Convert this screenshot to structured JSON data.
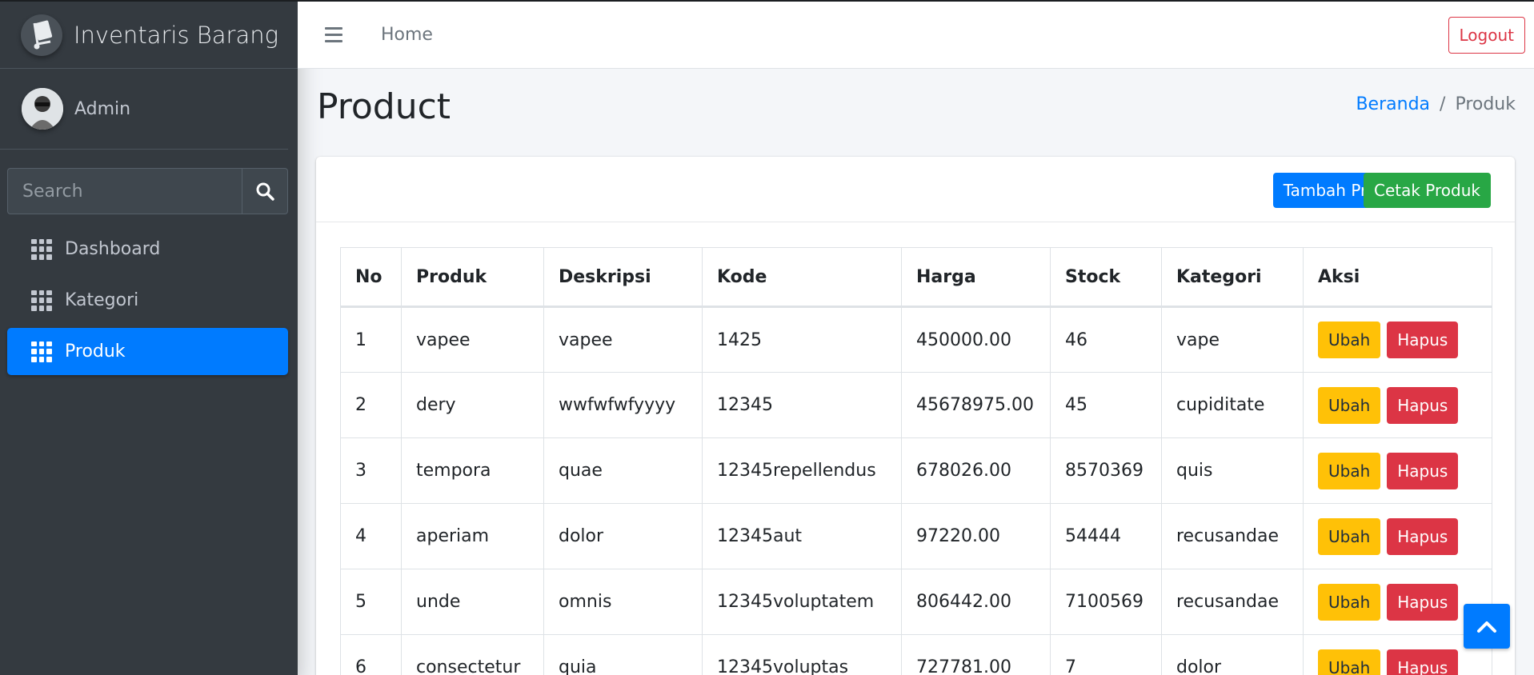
{
  "brand": {
    "title": "Inventaris Barang",
    "logo_icon": "hand-truck-icon"
  },
  "user": {
    "name": "Admin"
  },
  "sidebar": {
    "search_placeholder": "Search",
    "items": [
      {
        "label": "Dashboard",
        "icon": "grid-icon",
        "active": false
      },
      {
        "label": "Kategori",
        "icon": "grid-icon",
        "active": false
      },
      {
        "label": "Produk",
        "icon": "grid-icon",
        "active": true
      }
    ]
  },
  "header": {
    "home": "Home",
    "logout": "Logout"
  },
  "page": {
    "title": "Product",
    "breadcrumb": {
      "home": "Beranda",
      "separator": "/",
      "current": "Produk"
    }
  },
  "card": {
    "add_button": "Tambah Produk",
    "print_button": "Cetak Produk"
  },
  "table": {
    "headers": [
      "No",
      "Produk",
      "Deskripsi",
      "Kode",
      "Harga",
      "Stock",
      "Kategori",
      "Aksi"
    ],
    "edit_label": "Ubah",
    "delete_label": "Hapus",
    "rows": [
      [
        "1",
        "vapee",
        "vapee",
        "1425",
        "450000.00",
        "46",
        "vape"
      ],
      [
        "2",
        "dery",
        "wwfwfwfyyyy",
        "12345",
        "45678975.00",
        "45",
        "cupiditate"
      ],
      [
        "3",
        "tempora",
        "quae",
        "12345repellendus",
        "678026.00",
        "8570369",
        "quis"
      ],
      [
        "4",
        "aperiam",
        "dolor",
        "12345aut",
        "97220.00",
        "54444",
        "recusandae"
      ],
      [
        "5",
        "unde",
        "omnis",
        "12345voluptatem",
        "806442.00",
        "7100569",
        "recusandae"
      ],
      [
        "6",
        "consectetur",
        "quia",
        "12345voluptas",
        "727781.00",
        "7",
        "dolor"
      ]
    ]
  },
  "colors": {
    "primary": "#007bff",
    "success": "#28a745",
    "warning": "#ffc107",
    "danger": "#dc3545",
    "sidebar": "#343a40"
  }
}
